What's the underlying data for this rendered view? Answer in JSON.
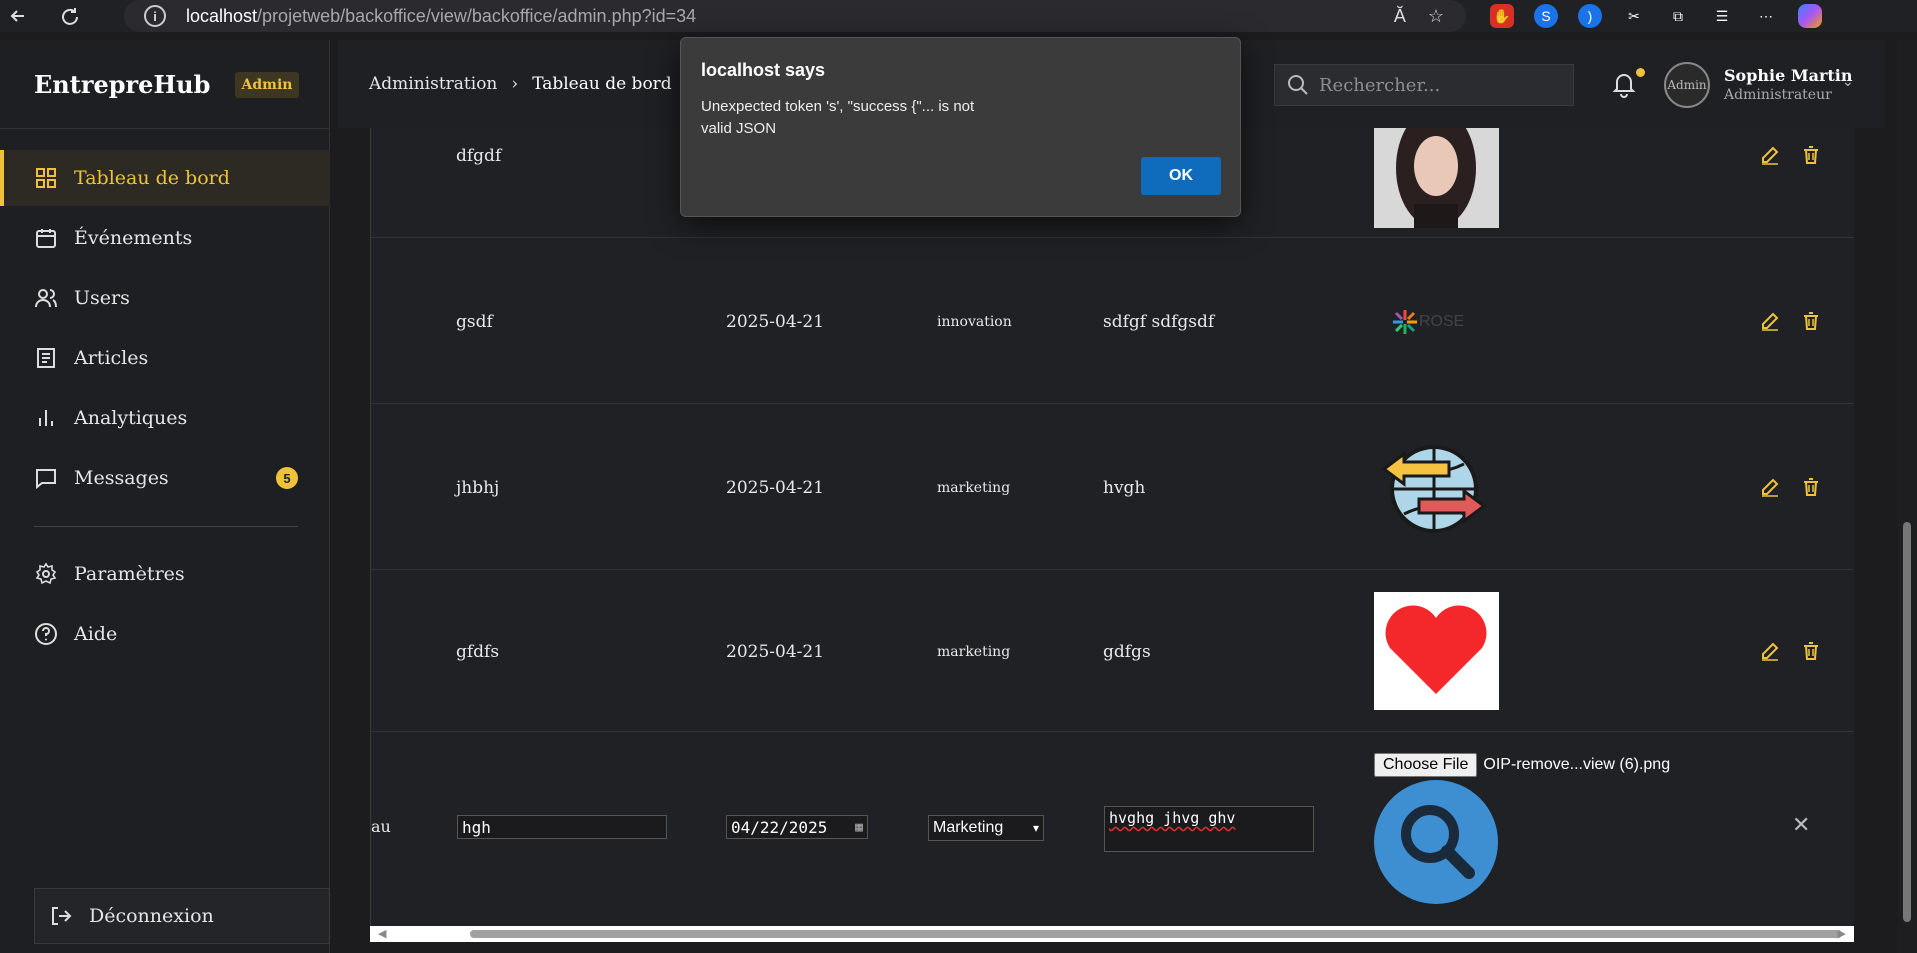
{
  "browser": {
    "url_host": "localhost",
    "url_path": "/projetweb/backoffice/view/backoffice/admin.php?id=34"
  },
  "sidebar": {
    "brand": "EntrepreHub",
    "badge": "Admin",
    "items": [
      {
        "label": "Tableau de bord",
        "icon": "dashboard-icon"
      },
      {
        "label": "Événements",
        "icon": "calendar-icon"
      },
      {
        "label": "Users",
        "icon": "users-icon"
      },
      {
        "label": "Articles",
        "icon": "articles-icon"
      },
      {
        "label": "Analytiques",
        "icon": "analytics-icon"
      },
      {
        "label": "Messages",
        "icon": "message-icon",
        "count": "5"
      },
      {
        "label": "Paramètres",
        "icon": "gear-icon"
      },
      {
        "label": "Aide",
        "icon": "help-icon"
      }
    ],
    "logout": "Déconnexion"
  },
  "header": {
    "breadcrumb_root": "Administration",
    "breadcrumb_current": "Tableau de bord",
    "search_placeholder": "Rechercher...",
    "user_name": "Sophie Martin",
    "user_role": "Administrateur",
    "avatar_alt": "Admin"
  },
  "table": {
    "rows": [
      {
        "title": "dfgdf",
        "date": "",
        "category": "",
        "desc": "",
        "image": "woman-photo"
      },
      {
        "title": "gsdf",
        "date": "2025-04-21",
        "category": "innovation",
        "desc": "sdfgf sdfgsdf",
        "image": "rose-logo"
      },
      {
        "title": "jhbhj",
        "date": "2025-04-21",
        "category": "marketing",
        "desc": "hvgh",
        "image": "globe-arrows"
      },
      {
        "title": "gfdfs",
        "date": "2025-04-21",
        "category": "marketing",
        "desc": "gdfgs",
        "image": "red-heart"
      }
    ],
    "edit_row": {
      "prefix": "au",
      "title": "hgh",
      "date": "04/22/2025",
      "category": "Marketing",
      "desc": "hvghg jhvg ghv",
      "file_button": "Choose File",
      "file_name": "OIP-remove...view (6).png",
      "image": "search-magnifier"
    }
  },
  "dialog": {
    "title": "localhost says",
    "message": "Unexpected token 's', \"success {\"... is not valid JSON",
    "ok": "OK"
  },
  "colors": {
    "accent": "#f0c23c",
    "dialog_button": "#0f6cbd"
  }
}
